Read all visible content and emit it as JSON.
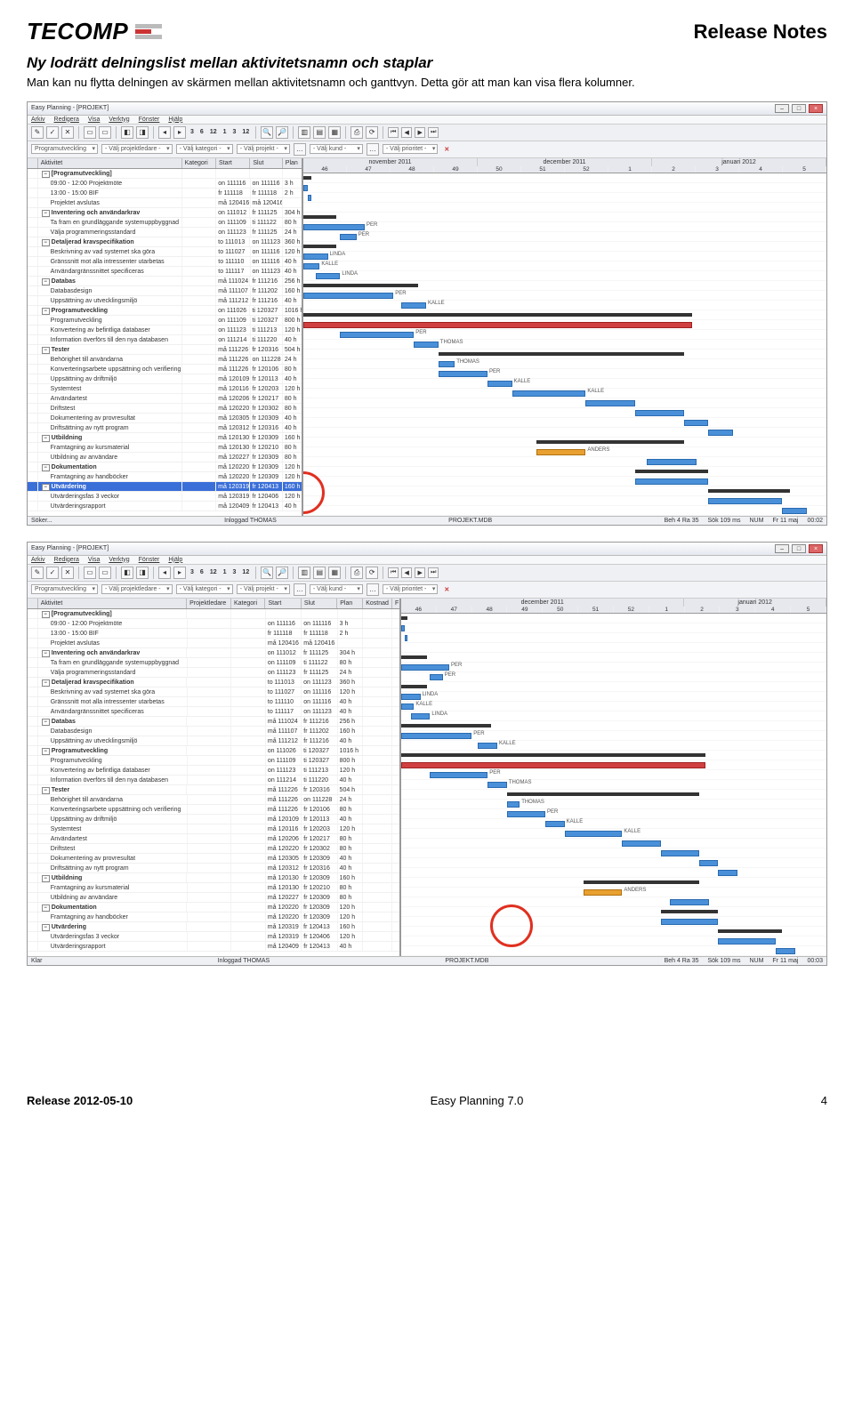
{
  "header": {
    "logo_text": "TECOMP",
    "release_notes": "Release Notes"
  },
  "section": {
    "title": "Ny lodrätt delningslist mellan aktivitetsnamn och staplar",
    "body": "Man kan nu flytta delningen av skärmen mellan aktivitetsnamn och ganttvyn. Detta gör att man kan visa flera kolumner."
  },
  "app": {
    "window_title": "Easy Planning - [PROJEKT]",
    "menus": [
      "Arkiv",
      "Redigera",
      "Visa",
      "Verktyg",
      "Fönster",
      "Hjälp"
    ],
    "toolbar_numbers": [
      "3",
      "6",
      "12",
      "1",
      "3",
      "12"
    ],
    "filters": {
      "program": "Programutveckling",
      "projektledare": "- Välj projektledare -",
      "kategori": "- Välj kategori -",
      "projekt": "- Välj projekt -",
      "kund": "- Välj kund -",
      "prioritet": "- Välj prioritet -"
    },
    "columns_narrow": [
      "Aktivitet",
      "Kategori",
      "Start",
      "Slut",
      "Plan"
    ],
    "columns_wide": [
      "Aktivitet",
      "Projektledare",
      "Kategori",
      "Start",
      "Slut",
      "Plan",
      "Kostnad",
      "F"
    ],
    "months1": [
      "november 2011",
      "december 2011",
      "januari 2012"
    ],
    "weeks1": [
      "46",
      "47",
      "48",
      "49",
      "50",
      "51",
      "52",
      "1",
      "2",
      "3",
      "4",
      "5"
    ],
    "months2": [
      "december 2011",
      "januari 2012"
    ],
    "weeks2": [
      "46",
      "47",
      "48",
      "49",
      "50",
      "51",
      "52",
      "1",
      "2",
      "3",
      "4",
      "5"
    ],
    "statusbar": {
      "left1_a": "Söker...",
      "left1_b": "Klar",
      "user": "Inloggad THOMAS",
      "db": "PROJEKT.MDB",
      "beh": "Beh 4 Ra 35",
      "sok": "Sök 109 ms",
      "num": "NUM",
      "date": "Fr 11 maj",
      "time_a": "00:02",
      "time_b": "00:03"
    }
  },
  "rows": [
    {
      "i": 0,
      "act": "[Programutveckling]",
      "bold": true,
      "exp": "−",
      "start": "",
      "slut": "",
      "plan": ""
    },
    {
      "i": 1,
      "act": "09:00 - 12:00 Projektmöte",
      "start": "on 111116",
      "slut": "on 111116",
      "plan": "3 h"
    },
    {
      "i": 2,
      "act": "13:00 - 15:00 BIF",
      "start": "fr 111118",
      "slut": "fr 111118",
      "plan": "2 h"
    },
    {
      "i": 3,
      "act": "Projektet avslutas",
      "start": "må 120416",
      "slut": "må 120416",
      "plan": ""
    },
    {
      "i": 4,
      "act": "Inventering och användarkrav",
      "bold": true,
      "exp": "−",
      "start": "on 111012",
      "slut": "fr 111125",
      "plan": "304 h"
    },
    {
      "i": 5,
      "act": "Ta fram en grundläggande systemuppbyggnad",
      "start": "on 111109",
      "slut": "ti 111122",
      "plan": "80 h",
      "label": "PER"
    },
    {
      "i": 6,
      "act": "Välja programmeringsstandard",
      "start": "on 111123",
      "slut": "fr 111125",
      "plan": "24 h",
      "label": "PER"
    },
    {
      "i": 7,
      "act": "Detaljerad kravspecifikation",
      "bold": true,
      "exp": "−",
      "start": "to 111013",
      "slut": "on 111123",
      "plan": "360 h"
    },
    {
      "i": 8,
      "act": "Beskrivning av vad systemet ska göra",
      "start": "to 111027",
      "slut": "on 111116",
      "plan": "120 h",
      "label": "LINDA"
    },
    {
      "i": 9,
      "act": "Gränssnitt mot alla intressenter utarbetas",
      "start": "to 111110",
      "slut": "on 111116",
      "plan": "40 h",
      "label": "KALLE"
    },
    {
      "i": 10,
      "act": "Användargränssnittet specificeras",
      "start": "to 111117",
      "slut": "on 111123",
      "plan": "40 h",
      "label": "LINDA"
    },
    {
      "i": 11,
      "act": "Databas",
      "bold": true,
      "exp": "−",
      "start": "må 111024",
      "slut": "fr 111216",
      "plan": "256 h"
    },
    {
      "i": 12,
      "act": "Databasdesign",
      "start": "må 111107",
      "slut": "fr 111202",
      "plan": "160 h",
      "label": "PER"
    },
    {
      "i": 13,
      "act": "Uppsättning av utvecklingsmiljö",
      "start": "må 111212",
      "slut": "fr 111216",
      "plan": "40 h",
      "label": "KALLE"
    },
    {
      "i": 14,
      "act": "Programutveckling",
      "bold": true,
      "exp": "−",
      "start": "on 111026",
      "slut": "ti 120327",
      "plan": "1016 h"
    },
    {
      "i": 15,
      "act": "Programutveckling",
      "start": "on 111109",
      "slut": "ti 120327",
      "plan": "800 h"
    },
    {
      "i": 16,
      "act": "Konvertering av befintliga databaser",
      "start": "on 111123",
      "slut": "ti 111213",
      "plan": "120 h",
      "label": "PER"
    },
    {
      "i": 17,
      "act": "Information överförs till den nya databasen",
      "start": "on 111214",
      "slut": "ti 111220",
      "plan": "40 h",
      "label": "THOMAS"
    },
    {
      "i": 18,
      "act": "Tester",
      "bold": true,
      "exp": "−",
      "start": "må 111226",
      "slut": "fr 120316",
      "plan": "504 h"
    },
    {
      "i": 19,
      "act": "Behörighet till användarna",
      "start": "må 111226",
      "slut": "on 111228",
      "plan": "24 h",
      "label": "THOMAS"
    },
    {
      "i": 20,
      "act": "Konverteringsarbete uppsättning och verifiering",
      "start": "må 111226",
      "slut": "fr 120106",
      "plan": "80 h",
      "label": "PER"
    },
    {
      "i": 21,
      "act": "Uppsättning av driftmiljö",
      "start": "må 120109",
      "slut": "fr 120113",
      "plan": "40 h",
      "label": "KALLE"
    },
    {
      "i": 22,
      "act": "Systemtest",
      "start": "må 120116",
      "slut": "fr 120203",
      "plan": "120 h",
      "label": "KALLE"
    },
    {
      "i": 23,
      "act": "Användartest",
      "start": "må 120206",
      "slut": "fr 120217",
      "plan": "80 h"
    },
    {
      "i": 24,
      "act": "Driftstest",
      "start": "må 120220",
      "slut": "fr 120302",
      "plan": "80 h"
    },
    {
      "i": 25,
      "act": "Dokumentering av provresultat",
      "start": "må 120305",
      "slut": "fr 120309",
      "plan": "40 h"
    },
    {
      "i": 26,
      "act": "Driftsättning av nytt program",
      "start": "må 120312",
      "slut": "fr 120316",
      "plan": "40 h"
    },
    {
      "i": 27,
      "act": "Utbildning",
      "bold": true,
      "exp": "−",
      "start": "må 120130",
      "slut": "fr 120309",
      "plan": "160 h"
    },
    {
      "i": 28,
      "act": "Framtagning av kursmaterial",
      "start": "må 120130",
      "slut": "fr 120210",
      "plan": "80 h",
      "label": "ANDERS"
    },
    {
      "i": 29,
      "act": "Utbildning av användare",
      "start": "må 120227",
      "slut": "fr 120309",
      "plan": "80 h"
    },
    {
      "i": 30,
      "act": "Dokumentation",
      "bold": true,
      "exp": "−",
      "start": "må 120220",
      "slut": "fr 120309",
      "plan": "120 h"
    },
    {
      "i": 31,
      "act": "Framtagning av handböcker",
      "start": "må 120220",
      "slut": "fr 120309",
      "plan": "120 h"
    },
    {
      "i": 32,
      "act": "Utvärdering",
      "bold": true,
      "exp": "−",
      "start": "må 120319",
      "slut": "fr 120413",
      "plan": "160 h",
      "selected": true
    },
    {
      "i": 33,
      "act": "Utvärderingsfas 3 veckor",
      "start": "må 120319",
      "slut": "fr 120406",
      "plan": "120 h"
    },
    {
      "i": 34,
      "act": "Utvärderingsrapport",
      "start": "må 120409",
      "slut": "fr 120413",
      "plan": "40 h"
    }
  ],
  "footer": {
    "left": "Release 2012-05-10",
    "center": "Easy Planning 7.0",
    "right": "4"
  }
}
